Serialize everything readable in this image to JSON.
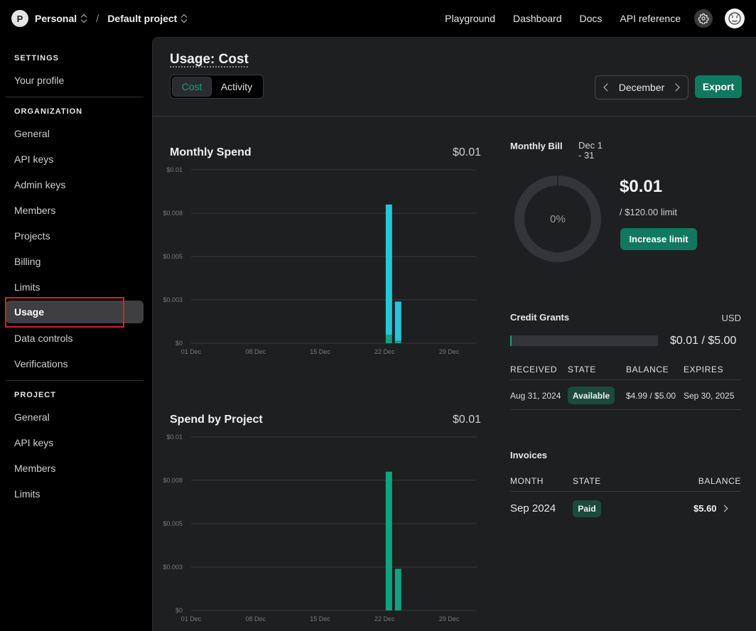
{
  "topbar": {
    "org_initial": "P",
    "org_name": "Personal",
    "project_name": "Default project",
    "separator": "/",
    "nav": [
      "Playground",
      "Dashboard",
      "Docs",
      "API reference"
    ]
  },
  "sidebar": {
    "settings_title": "SETTINGS",
    "settings_items": [
      "Your profile"
    ],
    "org_title": "ORGANIZATION",
    "org_items": [
      "General",
      "API keys",
      "Admin keys",
      "Members",
      "Projects",
      "Billing",
      "Limits",
      "Usage",
      "Data controls",
      "Verifications"
    ],
    "active_item": "Usage",
    "project_title": "PROJECT",
    "project_items": [
      "General",
      "API keys",
      "Members",
      "Limits"
    ]
  },
  "header": {
    "title": "Usage: Cost",
    "tabs": [
      "Cost",
      "Activity"
    ],
    "active_tab": "Cost",
    "month": "December",
    "export_label": "Export"
  },
  "monthly_spend": {
    "title": "Monthly Spend",
    "total": "$0.01"
  },
  "spend_by_project": {
    "title": "Spend by Project",
    "total": "$0.01"
  },
  "chart_data": [
    {
      "type": "bar",
      "title": "Monthly Spend",
      "x": [
        "22 Dec",
        "23 Dec"
      ],
      "values": [
        0.008,
        0.0024
      ],
      "x_ticks": [
        "01 Dec",
        "08 Dec",
        "15 Dec",
        "22 Dec",
        "29 Dec"
      ],
      "y_ticks": [
        "$0",
        "$0.003",
        "$0.005",
        "$0.008",
        "$0.01"
      ],
      "ylim": [
        0,
        0.01
      ],
      "grid": true,
      "colors": [
        "#24c6dc",
        "#10a37f"
      ]
    },
    {
      "type": "bar",
      "title": "Spend by Project",
      "x": [
        "22 Dec",
        "23 Dec"
      ],
      "values": [
        0.008,
        0.0024
      ],
      "x_ticks": [
        "01 Dec",
        "08 Dec",
        "15 Dec",
        "22 Dec",
        "29 Dec"
      ],
      "y_ticks": [
        "$0",
        "$0.003",
        "$0.005",
        "$0.008",
        "$0.01"
      ],
      "ylim": [
        0,
        0.01
      ],
      "grid": true,
      "colors": [
        "#10a37f"
      ]
    }
  ],
  "monthly_bill": {
    "label": "Monthly Bill",
    "range_line1": "Dec 1",
    "range_line2": "- 31",
    "percent": "0%",
    "percent_value": 0,
    "amount": "$0.01",
    "limit": "/ $120.00 limit",
    "increase_label": "Increase limit"
  },
  "credit_grants": {
    "label": "Credit Grants",
    "currency": "USD",
    "progress_fraction": 0.002,
    "summary": "$0.01 / $5.00",
    "columns": [
      "RECEIVED",
      "STATE",
      "BALANCE",
      "EXPIRES"
    ],
    "rows": [
      {
        "received": "Aug 31, 2024",
        "state": "Available",
        "balance": "$4.99 / $5.00",
        "expires": "Sep 30, 2025"
      }
    ]
  },
  "invoices": {
    "label": "Invoices",
    "columns": [
      "MONTH",
      "STATE",
      "BALANCE"
    ],
    "rows": [
      {
        "month": "Sep 2024",
        "state": "Paid",
        "balance": "$5.60"
      }
    ]
  },
  "colors": {
    "accent": "#10a37f",
    "cyan": "#24c6dc",
    "highlight": "#d0232a"
  }
}
